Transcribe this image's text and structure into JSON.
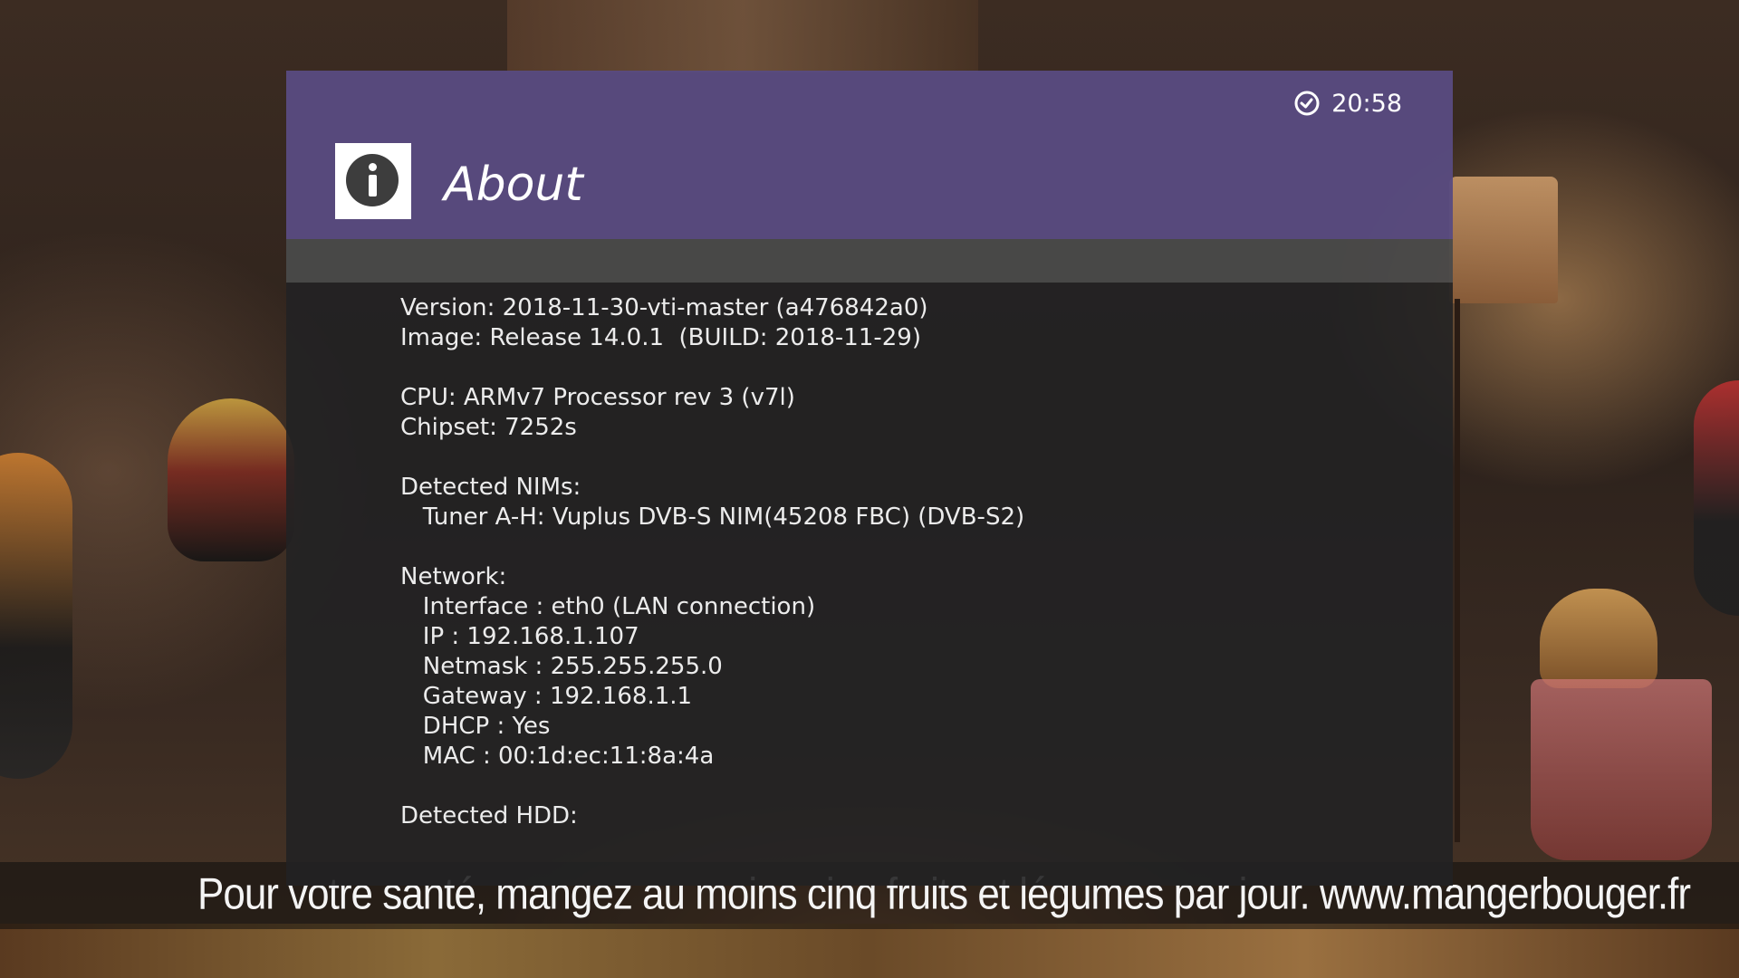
{
  "header": {
    "title": "About",
    "clock": "20:58",
    "info_icon": "info-icon",
    "clock_icon": "clock-icon"
  },
  "info_text": "Version: 2018-11-30-vti-master (a476842a0)\nImage: Release 14.0.1  (BUILD: 2018-11-29)\n\nCPU: ARMv7 Processor rev 3 (v7l)\nChipset: 7252s\n\nDetected NIMs:\n   Tuner A-H: Vuplus DVB-S NIM(45208 FBC) (DVB-S2)\n\nNetwork:\n   Interface : eth0 (LAN connection)\n   IP : 192.168.1.107\n   Netmask : 255.255.255.0\n   Gateway : 192.168.1.1\n   DHCP : Yes\n   MAC : 00:1d:ec:11:8a:4a\n\nDetected HDD:",
  "subtitle": "Pour votre santé, mangez au moins cinq fruits et légumes par jour. www.mangerbouger.fr",
  "colors": {
    "header_purple": "#584b80",
    "strip_gray": "#4a4a4a",
    "body_dark": "#222224",
    "text": "#ececec"
  }
}
